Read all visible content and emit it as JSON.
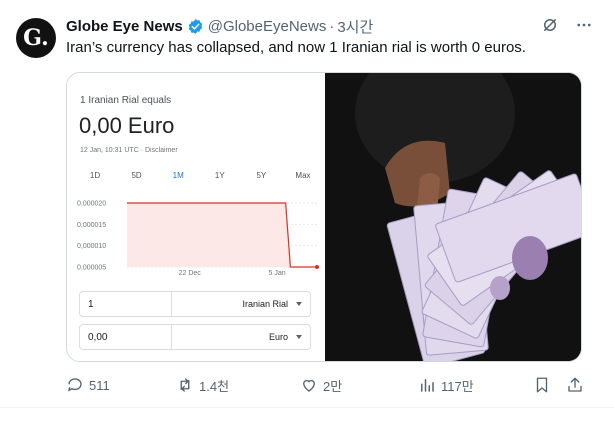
{
  "author": {
    "avatar_letter": "G.",
    "name": "Globe Eye News",
    "handle": "@GlobeEyeNews",
    "separator": "·",
    "time": "3시간"
  },
  "tweet_text": "Iran’s currency has collapsed, and now 1 Iranian rial is worth 0 euros.",
  "widget": {
    "subtitle": "1 Iranian Rial equals",
    "value": "0,00 Euro",
    "date_line": "12 Jan, 10:31 UTC · Disclaimer",
    "ranges": [
      "1D",
      "5D",
      "1M",
      "1Y",
      "5Y",
      "Max"
    ],
    "active_range": "1M",
    "from_amount": "1",
    "from_currency": "Iranian Rial",
    "to_amount": "0,00",
    "to_currency": "Euro"
  },
  "chart_data": {
    "type": "area",
    "y_ticks": [
      "0,000020",
      "0,000015",
      "0,000010",
      "0,000005"
    ],
    "x_ticks": [
      "22 Dec",
      "5 Jan"
    ],
    "ylim": [
      5e-06,
      2e-05
    ],
    "points": [
      [
        0,
        2e-05
      ],
      [
        0.835,
        2e-05
      ],
      [
        0.86,
        5e-06
      ],
      [
        1,
        5e-06
      ]
    ],
    "line_color": "#d93025",
    "fill_color": "#fce8e6"
  },
  "actions": {
    "replies": "511",
    "retweets": "1.4천",
    "likes": "2만",
    "views": "117만"
  },
  "colors": {
    "verified": "#1d9bf0",
    "muted": "#536471"
  }
}
